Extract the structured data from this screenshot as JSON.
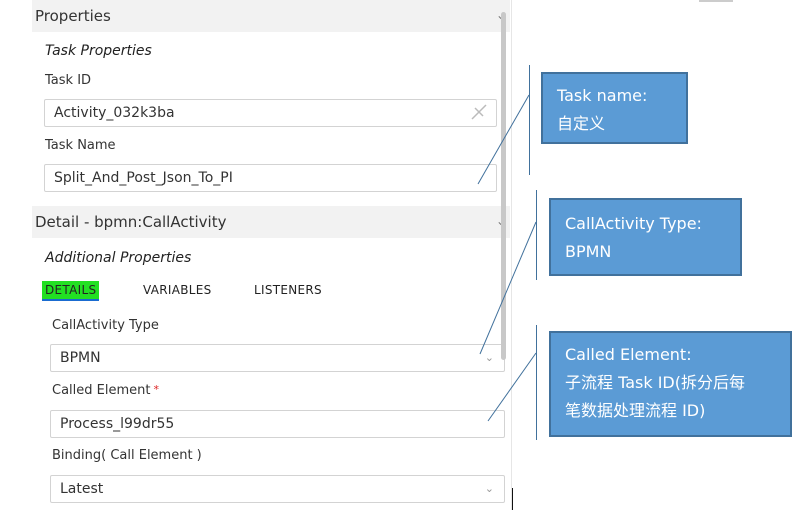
{
  "properties": {
    "header": "Properties",
    "group_title": "Task Properties",
    "task_id": {
      "label": "Task ID",
      "value": "Activity_032k3ba"
    },
    "task_name": {
      "label": "Task Name",
      "value": "Split_And_Post_Json_To_PI"
    }
  },
  "detail": {
    "header": "Detail - bpmn:CallActivity",
    "group_title": "Additional Properties",
    "tabs": [
      {
        "label": "DETAILS",
        "active": true
      },
      {
        "label": "VARIABLES",
        "active": false
      },
      {
        "label": "LISTENERS",
        "active": false
      }
    ],
    "call_activity_type": {
      "label": "CallActivity Type",
      "value": "BPMN"
    },
    "called_element": {
      "label": "Called Element",
      "required_mark": "*",
      "value": "Process_l99dr55"
    },
    "binding": {
      "label": "Binding( Call Element )",
      "value": "Latest"
    }
  },
  "callouts": [
    {
      "lines": [
        "Task name:",
        "自定义"
      ]
    },
    {
      "lines": [
        "CallActivity Type:",
        "BPMN"
      ]
    },
    {
      "lines": [
        "Called Element:",
        "子流程 Task ID(拆分后每",
        "笔数据处理流程 ID)"
      ]
    }
  ],
  "colors": {
    "callout_fill": "#5b9bd5",
    "callout_border": "#41719c",
    "active_tab_highlight": "#22e022",
    "active_tab_underline": "#1a6bd0",
    "section_header_bg": "#f2f2f2"
  }
}
